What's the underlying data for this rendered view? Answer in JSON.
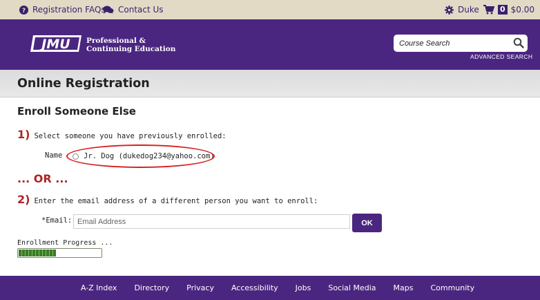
{
  "colors": {
    "purple": "#4b2680",
    "gold_bar": "#e3dac6",
    "accent_red": "#b02424",
    "highlight_ellipse": "#d81e1e",
    "progress_green": "#3c7a2a"
  },
  "topbar": {
    "faq": {
      "icon": "question-circle-icon",
      "label": "Registration FAQs"
    },
    "contact": {
      "icon": "chat-bubbles-icon",
      "label": "Contact Us"
    },
    "user": {
      "icon": "gear-icon",
      "label": "Duke"
    },
    "cart": {
      "icon": "cart-icon",
      "count": "0",
      "total": "$0.00"
    }
  },
  "header": {
    "logo": {
      "mark": "JMU",
      "line1": "Professional &",
      "line2": "Continuing Education"
    },
    "search": {
      "placeholder": "Course Search",
      "value": "",
      "icon": "search-icon"
    },
    "advanced_search": "ADVANCED SEARCH"
  },
  "page": {
    "title": "Online Registration"
  },
  "main": {
    "section_title": "Enroll Someone Else",
    "step1": {
      "number": "1)",
      "text": "Select someone you have previously enrolled:"
    },
    "name_label": "Name",
    "person_option": {
      "label": "Jr. Dog (dukedog234@yahoo.com)",
      "selected": false
    },
    "or_text": "... OR ...",
    "step2": {
      "number": "2)",
      "text": "Enter the email address of a different person you want to enroll:"
    },
    "email_label": "*Email:",
    "email_placeholder": "Email Address",
    "email_value": "",
    "ok_button": "OK",
    "progress": {
      "label": "Enrollment Progress ...",
      "fraction": 0.45
    }
  },
  "footer": {
    "links": [
      "A-Z Index",
      "Directory",
      "Privacy",
      "Accessibility",
      "Jobs",
      "Social Media",
      "Maps",
      "Community"
    ]
  }
}
